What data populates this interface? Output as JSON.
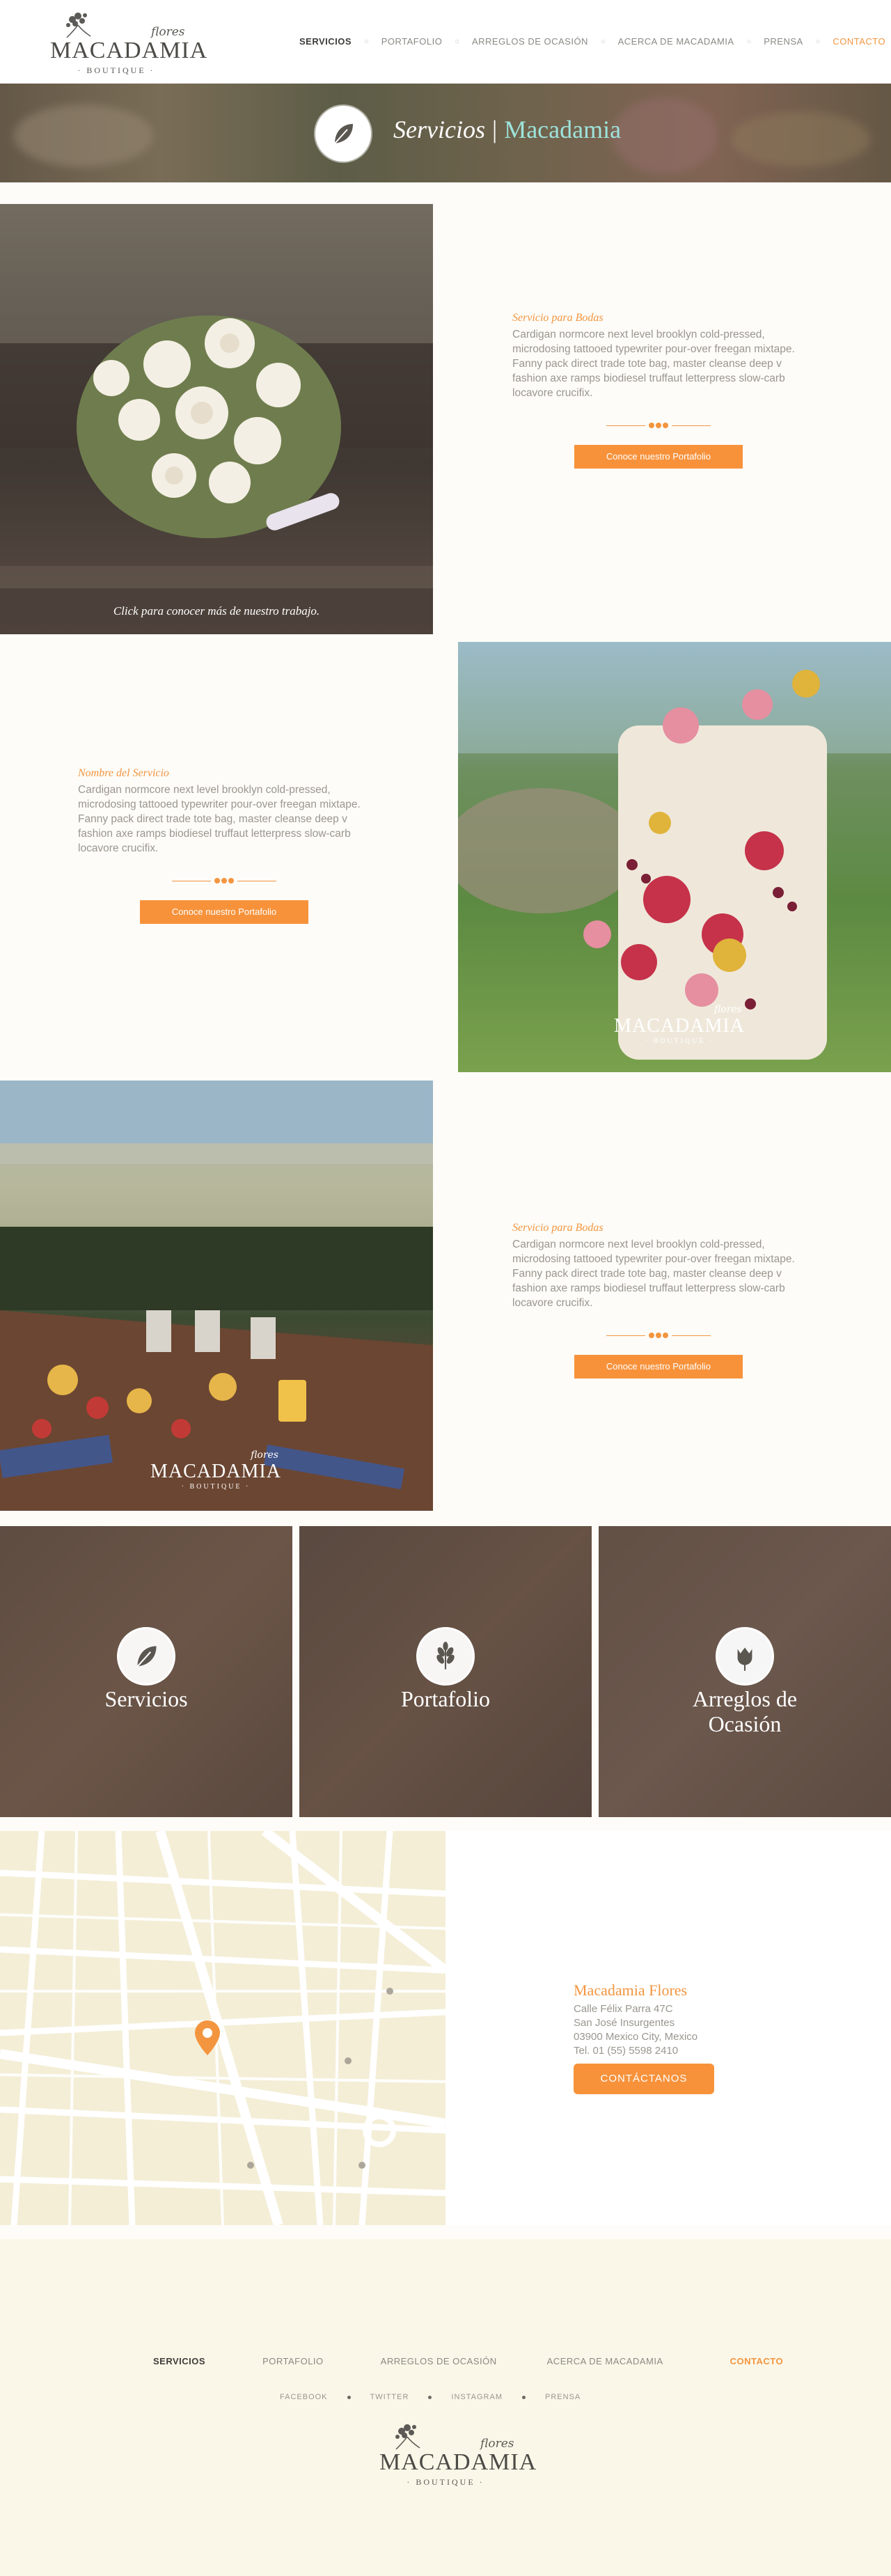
{
  "header": {
    "logo": {
      "flores": "flores",
      "brand": "MACADAMIA",
      "boutique": "· BOUTIQUE ·"
    },
    "nav": [
      {
        "label": "SERVICIOS"
      },
      {
        "label": "PORTAFOLIO"
      },
      {
        "label": "ARREGLOS DE OCASIÓN"
      },
      {
        "label": "ACERCA DE MACADAMIA"
      },
      {
        "label": "PRENSA"
      },
      {
        "label": "CONTACTO"
      }
    ]
  },
  "banner": {
    "title": "Servicios",
    "divider": "|",
    "accent": "Macadamia"
  },
  "services": [
    {
      "title": "Servicio para Bodas",
      "description": "Cardigan normcore next level brooklyn cold-pressed, microdosing tattooed typewriter pour-over freegan mixtape. Fanny pack direct trade tote bag, master cleanse deep v fashion axe ramps biodiesel truffaut letterpress slow-carb locavore crucifix.",
      "button": "Conoce nuestro Portafolio",
      "caption": "Click para conocer más de nuestro trabajo."
    },
    {
      "title": "Nombre del Servicio",
      "description": "Cardigan normcore next level brooklyn cold-pressed, microdosing tattooed typewriter pour-over freegan mixtape. Fanny pack direct trade tote bag, master cleanse deep v fashion axe ramps biodiesel truffaut letterpress slow-carb locavore crucifix.",
      "button": "Conoce nuestro Portafolio"
    },
    {
      "title": "Servicio para Bodas",
      "description": "Cardigan normcore next level brooklyn cold-pressed, microdosing tattooed typewriter pour-over freegan mixtape. Fanny pack direct trade tote bag, master cleanse deep v fashion axe ramps biodiesel truffaut letterpress slow-carb locavore crucifix.",
      "button": "Conoce nuestro Portafolio"
    }
  ],
  "tiles": [
    {
      "label": "Servicios",
      "icon": "leaf-icon"
    },
    {
      "label": "Portafolio",
      "icon": "wheat-icon"
    },
    {
      "label": "Arreglos de Ocasión",
      "icon": "tulip-icon"
    }
  ],
  "contact": {
    "name": "Macadamia Flores",
    "lines": [
      "Calle Félix Parra 47C",
      "San José Insurgentes",
      "03900 Mexico City, Mexico",
      "Tel. 01 (55) 5598 2410"
    ],
    "button": "CONTÁCTANOS"
  },
  "footer": {
    "nav": [
      {
        "label": "SERVICIOS"
      },
      {
        "label": "PORTAFOLIO"
      },
      {
        "label": "ARREGLOS DE OCASIÓN"
      },
      {
        "label": "ACERCA DE MACADAMIA"
      },
      {
        "label": "CONTACTO"
      }
    ],
    "social": [
      "FACEBOOK",
      "TWITTER",
      "INSTAGRAM",
      "PRENSA"
    ]
  },
  "colors": {
    "accent": "#f3953f",
    "button": "#f7923b",
    "teal": "#9ee3dc",
    "tile_overlay": "#5f4e44",
    "footer_bg": "#fbf7e8"
  }
}
